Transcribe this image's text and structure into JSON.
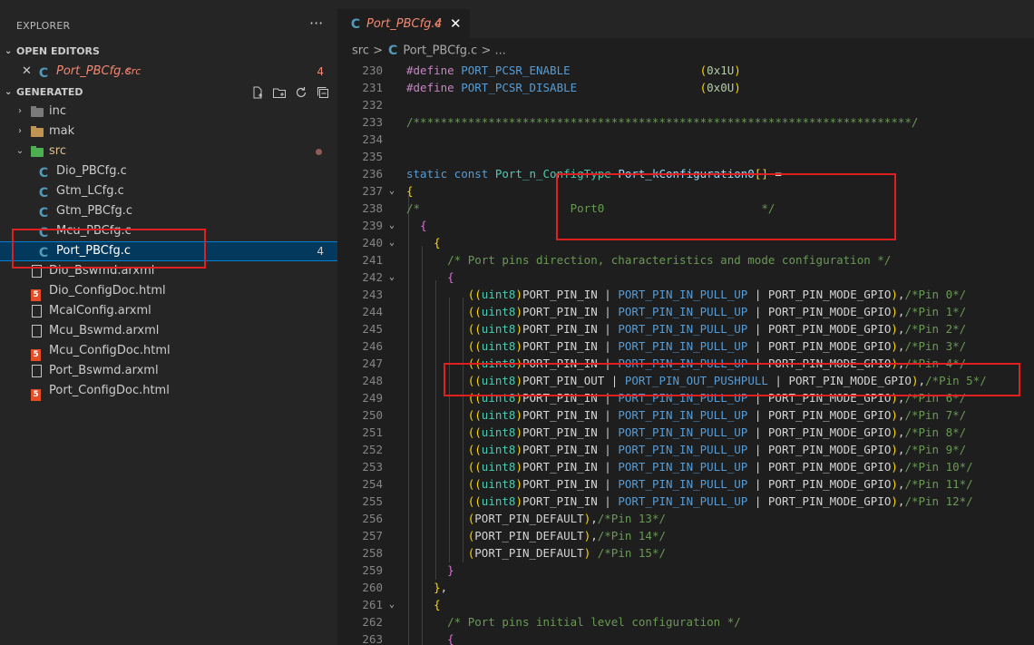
{
  "sidebar": {
    "title": "EXPLORER",
    "more": "···",
    "open_editors": {
      "title": "OPEN EDITORS",
      "file": {
        "name": "Port_PBCfg.c",
        "folder": "src",
        "problems": "4"
      }
    },
    "workspace": {
      "title": "GENERATED",
      "actions": [
        "new-file-icon",
        "new-folder-icon",
        "refresh-icon",
        "collapse-all-icon"
      ],
      "items": [
        {
          "label": "inc",
          "type": "folder",
          "expanded": false
        },
        {
          "label": "mak",
          "type": "folder",
          "expanded": false
        },
        {
          "label": "src",
          "type": "folder",
          "expanded": true,
          "modified": true
        },
        {
          "label": "Dio_PBCfg.c",
          "type": "c"
        },
        {
          "label": "Gtm_LCfg.c",
          "type": "c"
        },
        {
          "label": "Gtm_PBCfg.c",
          "type": "c"
        },
        {
          "label": "Mcu_PBCfg.c",
          "type": "c"
        },
        {
          "label": "Port_PBCfg.c",
          "type": "c",
          "selected": true,
          "badge": "4"
        },
        {
          "label": "Dio_Bswmd.arxml",
          "type": "file"
        },
        {
          "label": "Dio_ConfigDoc.html",
          "type": "html"
        },
        {
          "label": "McalConfig.arxml",
          "type": "file"
        },
        {
          "label": "Mcu_Bswmd.arxml",
          "type": "file"
        },
        {
          "label": "Mcu_ConfigDoc.html",
          "type": "html"
        },
        {
          "label": "Port_Bswmd.arxml",
          "type": "file"
        },
        {
          "label": "Port_ConfigDoc.html",
          "type": "html"
        }
      ]
    }
  },
  "editor": {
    "tab": {
      "label": "Port_PBCfg.c",
      "count": "4",
      "close": "✕"
    },
    "breadcrumb": {
      "folder": "src",
      "sep": ">",
      "file": "Port_PBCfg.c",
      "more": "..."
    },
    "lines": [
      {
        "n": "230",
        "tokens": [
          [
            "pp",
            "#define "
          ],
          [
            "mac",
            "PORT_PCSR_ENABLE"
          ],
          [
            "plain",
            "                   "
          ],
          [
            "b1",
            "("
          ],
          [
            "num",
            "0x1U"
          ],
          [
            "b1",
            ")"
          ]
        ]
      },
      {
        "n": "231",
        "tokens": [
          [
            "pp",
            "#define "
          ],
          [
            "mac",
            "PORT_PCSR_DISABLE"
          ],
          [
            "plain",
            "                  "
          ],
          [
            "b1",
            "("
          ],
          [
            "num",
            "0x0U"
          ],
          [
            "b1",
            ")"
          ]
        ]
      },
      {
        "n": "232",
        "tokens": []
      },
      {
        "n": "233",
        "tokens": [
          [
            "cm",
            "/*************************************************************************/"
          ]
        ]
      },
      {
        "n": "234",
        "tokens": []
      },
      {
        "n": "235",
        "tokens": []
      },
      {
        "n": "236",
        "tokens": [
          [
            "kw",
            "static const "
          ],
          [
            "ty",
            "Port_n_ConfigType "
          ],
          [
            "var",
            "Port_kConfiguration0"
          ],
          [
            "b1",
            "[]"
          ],
          [
            "plain",
            " ="
          ]
        ]
      },
      {
        "n": "237",
        "fold": "⌄",
        "tokens": [
          [
            "b1",
            "{"
          ]
        ]
      },
      {
        "n": "238",
        "tokens": [
          [
            "cm",
            "/*                      Port0                       */"
          ]
        ]
      },
      {
        "n": "239",
        "fold": "⌄",
        "tokens": [
          [
            "plain",
            "  "
          ],
          [
            "b2",
            "{"
          ]
        ]
      },
      {
        "n": "240",
        "fold": "⌄",
        "tokens": [
          [
            "plain",
            "    "
          ],
          [
            "b1",
            "{"
          ]
        ]
      },
      {
        "n": "241",
        "tokens": [
          [
            "plain",
            "      "
          ],
          [
            "cm",
            "/* Port pins direction, characteristics and mode configuration */"
          ]
        ]
      },
      {
        "n": "242",
        "fold": "⌄",
        "tokens": [
          [
            "plain",
            "      "
          ],
          [
            "b2",
            "{"
          ]
        ]
      },
      {
        "n": "243",
        "tokens": [
          [
            "plain",
            "         "
          ],
          [
            "b1",
            "(("
          ],
          [
            "ty",
            "uint8"
          ],
          [
            "b1",
            ")"
          ],
          [
            "plain",
            "PORT_PIN_IN | "
          ],
          [
            "mac",
            "PORT_PIN_IN_PULL_UP"
          ],
          [
            "plain",
            " | PORT_PIN_MODE_GPIO"
          ],
          [
            "b1",
            ")"
          ],
          [
            "plain",
            ","
          ],
          [
            "cm",
            "/*Pin 0*/"
          ]
        ]
      },
      {
        "n": "244",
        "tokens": [
          [
            "plain",
            "         "
          ],
          [
            "b1",
            "(("
          ],
          [
            "ty",
            "uint8"
          ],
          [
            "b1",
            ")"
          ],
          [
            "plain",
            "PORT_PIN_IN | "
          ],
          [
            "mac",
            "PORT_PIN_IN_PULL_UP"
          ],
          [
            "plain",
            " | PORT_PIN_MODE_GPIO"
          ],
          [
            "b1",
            ")"
          ],
          [
            "plain",
            ","
          ],
          [
            "cm",
            "/*Pin 1*/"
          ]
        ]
      },
      {
        "n": "245",
        "tokens": [
          [
            "plain",
            "         "
          ],
          [
            "b1",
            "(("
          ],
          [
            "ty",
            "uint8"
          ],
          [
            "b1",
            ")"
          ],
          [
            "plain",
            "PORT_PIN_IN | "
          ],
          [
            "mac",
            "PORT_PIN_IN_PULL_UP"
          ],
          [
            "plain",
            " | PORT_PIN_MODE_GPIO"
          ],
          [
            "b1",
            ")"
          ],
          [
            "plain",
            ","
          ],
          [
            "cm",
            "/*Pin 2*/"
          ]
        ]
      },
      {
        "n": "246",
        "tokens": [
          [
            "plain",
            "         "
          ],
          [
            "b1",
            "(("
          ],
          [
            "ty",
            "uint8"
          ],
          [
            "b1",
            ")"
          ],
          [
            "plain",
            "PORT_PIN_IN | "
          ],
          [
            "mac",
            "PORT_PIN_IN_PULL_UP"
          ],
          [
            "plain",
            " | PORT_PIN_MODE_GPIO"
          ],
          [
            "b1",
            ")"
          ],
          [
            "plain",
            ","
          ],
          [
            "cm",
            "/*Pin 3*/"
          ]
        ]
      },
      {
        "n": "247",
        "tokens": [
          [
            "plain",
            "         "
          ],
          [
            "b1",
            "(("
          ],
          [
            "ty",
            "uint8"
          ],
          [
            "b1",
            ")"
          ],
          [
            "plain",
            "PORT_PIN_IN | "
          ],
          [
            "mac",
            "PORT_PIN_IN_PULL_UP"
          ],
          [
            "plain",
            " | PORT_PIN_MODE_GPIO"
          ],
          [
            "b1",
            ")"
          ],
          [
            "plain",
            ","
          ],
          [
            "cm",
            "/*Pin 4*/"
          ]
        ]
      },
      {
        "n": "248",
        "tokens": [
          [
            "plain",
            "         "
          ],
          [
            "b1",
            "(("
          ],
          [
            "ty",
            "uint8"
          ],
          [
            "b1",
            ")"
          ],
          [
            "plain",
            "PORT_PIN_OUT | "
          ],
          [
            "mac",
            "PORT_PIN_OUT_PUSHPULL"
          ],
          [
            "plain",
            " | PORT_PIN_MODE_GPIO"
          ],
          [
            "b1",
            ")"
          ],
          [
            "plain",
            ","
          ],
          [
            "cm",
            "/*Pin 5*/"
          ]
        ]
      },
      {
        "n": "249",
        "tokens": [
          [
            "plain",
            "         "
          ],
          [
            "b1",
            "(("
          ],
          [
            "ty",
            "uint8"
          ],
          [
            "b1",
            ")"
          ],
          [
            "plain",
            "PORT_PIN_IN | "
          ],
          [
            "mac",
            "PORT_PIN_IN_PULL_UP"
          ],
          [
            "plain",
            " | PORT_PIN_MODE_GPIO"
          ],
          [
            "b1",
            ")"
          ],
          [
            "plain",
            ","
          ],
          [
            "cm",
            "/*Pin 6*/"
          ]
        ]
      },
      {
        "n": "250",
        "tokens": [
          [
            "plain",
            "         "
          ],
          [
            "b1",
            "(("
          ],
          [
            "ty",
            "uint8"
          ],
          [
            "b1",
            ")"
          ],
          [
            "plain",
            "PORT_PIN_IN | "
          ],
          [
            "mac",
            "PORT_PIN_IN_PULL_UP"
          ],
          [
            "plain",
            " | PORT_PIN_MODE_GPIO"
          ],
          [
            "b1",
            ")"
          ],
          [
            "plain",
            ","
          ],
          [
            "cm",
            "/*Pin 7*/"
          ]
        ]
      },
      {
        "n": "251",
        "tokens": [
          [
            "plain",
            "         "
          ],
          [
            "b1",
            "(("
          ],
          [
            "ty",
            "uint8"
          ],
          [
            "b1",
            ")"
          ],
          [
            "plain",
            "PORT_PIN_IN | "
          ],
          [
            "mac",
            "PORT_PIN_IN_PULL_UP"
          ],
          [
            "plain",
            " | PORT_PIN_MODE_GPIO"
          ],
          [
            "b1",
            ")"
          ],
          [
            "plain",
            ","
          ],
          [
            "cm",
            "/*Pin 8*/"
          ]
        ]
      },
      {
        "n": "252",
        "tokens": [
          [
            "plain",
            "         "
          ],
          [
            "b1",
            "(("
          ],
          [
            "ty",
            "uint8"
          ],
          [
            "b1",
            ")"
          ],
          [
            "plain",
            "PORT_PIN_IN | "
          ],
          [
            "mac",
            "PORT_PIN_IN_PULL_UP"
          ],
          [
            "plain",
            " | PORT_PIN_MODE_GPIO"
          ],
          [
            "b1",
            ")"
          ],
          [
            "plain",
            ","
          ],
          [
            "cm",
            "/*Pin 9*/"
          ]
        ]
      },
      {
        "n": "253",
        "tokens": [
          [
            "plain",
            "         "
          ],
          [
            "b1",
            "(("
          ],
          [
            "ty",
            "uint8"
          ],
          [
            "b1",
            ")"
          ],
          [
            "plain",
            "PORT_PIN_IN | "
          ],
          [
            "mac",
            "PORT_PIN_IN_PULL_UP"
          ],
          [
            "plain",
            " | PORT_PIN_MODE_GPIO"
          ],
          [
            "b1",
            ")"
          ],
          [
            "plain",
            ","
          ],
          [
            "cm",
            "/*Pin 10*/"
          ]
        ]
      },
      {
        "n": "254",
        "tokens": [
          [
            "plain",
            "         "
          ],
          [
            "b1",
            "(("
          ],
          [
            "ty",
            "uint8"
          ],
          [
            "b1",
            ")"
          ],
          [
            "plain",
            "PORT_PIN_IN | "
          ],
          [
            "mac",
            "PORT_PIN_IN_PULL_UP"
          ],
          [
            "plain",
            " | PORT_PIN_MODE_GPIO"
          ],
          [
            "b1",
            ")"
          ],
          [
            "plain",
            ","
          ],
          [
            "cm",
            "/*Pin 11*/"
          ]
        ]
      },
      {
        "n": "255",
        "tokens": [
          [
            "plain",
            "         "
          ],
          [
            "b1",
            "(("
          ],
          [
            "ty",
            "uint8"
          ],
          [
            "b1",
            ")"
          ],
          [
            "plain",
            "PORT_PIN_IN | "
          ],
          [
            "mac",
            "PORT_PIN_IN_PULL_UP"
          ],
          [
            "plain",
            " | PORT_PIN_MODE_GPIO"
          ],
          [
            "b1",
            ")"
          ],
          [
            "plain",
            ","
          ],
          [
            "cm",
            "/*Pin 12*/"
          ]
        ]
      },
      {
        "n": "256",
        "tokens": [
          [
            "plain",
            "         "
          ],
          [
            "b1",
            "("
          ],
          [
            "plain",
            "PORT_PIN_DEFAULT"
          ],
          [
            "b1",
            ")"
          ],
          [
            "plain",
            ","
          ],
          [
            "cm",
            "/*Pin 13*/"
          ]
        ]
      },
      {
        "n": "257",
        "tokens": [
          [
            "plain",
            "         "
          ],
          [
            "b1",
            "("
          ],
          [
            "plain",
            "PORT_PIN_DEFAULT"
          ],
          [
            "b1",
            ")"
          ],
          [
            "plain",
            ","
          ],
          [
            "cm",
            "/*Pin 14*/"
          ]
        ]
      },
      {
        "n": "258",
        "tokens": [
          [
            "plain",
            "         "
          ],
          [
            "b1",
            "("
          ],
          [
            "plain",
            "PORT_PIN_DEFAULT"
          ],
          [
            "b1",
            ")"
          ],
          [
            "plain",
            " "
          ],
          [
            "cm",
            "/*Pin 15*/"
          ]
        ]
      },
      {
        "n": "259",
        "tokens": [
          [
            "plain",
            "      "
          ],
          [
            "b2",
            "}"
          ]
        ]
      },
      {
        "n": "260",
        "tokens": [
          [
            "plain",
            "    "
          ],
          [
            "b1",
            "}"
          ],
          [
            "plain",
            ","
          ]
        ]
      },
      {
        "n": "261",
        "fold": "⌄",
        "tokens": [
          [
            "plain",
            "    "
          ],
          [
            "b1",
            "{"
          ]
        ]
      },
      {
        "n": "262",
        "tokens": [
          [
            "plain",
            "      "
          ],
          [
            "cm",
            "/* Port pins initial level configuration */"
          ]
        ]
      },
      {
        "n": "263",
        "tokens": [
          [
            "plain",
            "      "
          ],
          [
            "b2",
            "{"
          ]
        ]
      }
    ]
  },
  "colors": {
    "accent": "#007fd4",
    "highlight_box": "#e02020",
    "modified_tab": "#f48771"
  }
}
